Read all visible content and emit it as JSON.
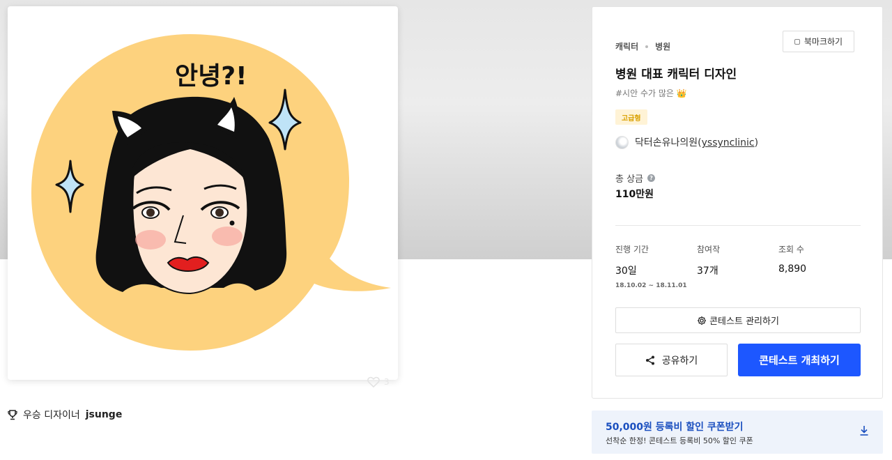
{
  "artwork": {
    "speech_text": "안녕?!",
    "like_count": "3"
  },
  "winner": {
    "label": "우승 디자이너",
    "name": "jsunge"
  },
  "contest": {
    "category": "캐릭터",
    "subcategory": "병원",
    "bookmark_label": "북마크하기",
    "title": "병원 대표 캐릭터 디자인",
    "tags": "#시안 수가 많은 👑",
    "grade": "고급형",
    "host_name": "닥터손유나의원",
    "host_handle": "yssynclinic",
    "prize_label": "총 상금",
    "prize_value": "110만원",
    "stats": {
      "period_label": "진행 기간",
      "period_value": "30일",
      "period_dates": "18.10.02 ~ 18.11.01",
      "entries_label": "참여작",
      "entries_value": "37개",
      "views_label": "조회 수",
      "views_value": "8,890"
    },
    "manage_label": "콘테스트 관리하기",
    "share_label": "공유하기",
    "host_contest_label": "콘테스트 개최하기"
  },
  "coupon": {
    "headline": "50,000원 등록비 할인 쿠폰받기",
    "description": "선착순 한정! 콘테스트 등록비 50% 할인 쿠폰"
  },
  "colors": {
    "primary": "#1d57ff",
    "coupon_text": "#1a4fbf",
    "badge_bg": "#fff3d6",
    "badge_text": "#d9a000",
    "bubble": "#fdd27e"
  },
  "icons": {
    "bookmark": "bookmark-icon",
    "gear": "gear-icon",
    "share": "share-icon",
    "download": "download-icon",
    "trophy": "trophy-icon",
    "heart": "heart-icon",
    "help": "help-icon"
  }
}
